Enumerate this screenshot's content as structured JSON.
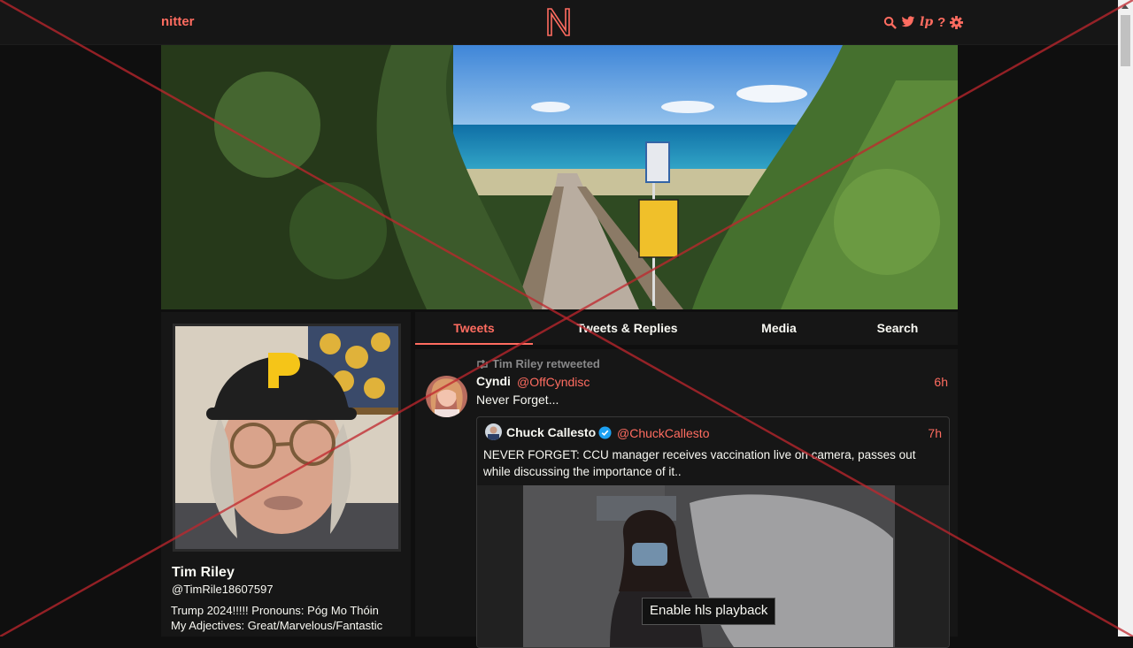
{
  "nav": {
    "brand": "nitter",
    "logo_letter": "N",
    "icons": [
      "search-icon",
      "twitter-bird-icon",
      "liberapay-icon",
      "help-icon",
      "settings-gear-icon"
    ],
    "lp_glyph": "lp",
    "help_glyph": "?"
  },
  "profile": {
    "fullname": "Tim Riley",
    "username": "@TimRile18607597",
    "bio_line1": "Trump 2024!!!!! Pronouns: Póg Mo Thóin",
    "bio_line2": "My Adjectives: Great/Marvelous/Fantastic"
  },
  "tabs": [
    {
      "label": "Tweets",
      "active": true
    },
    {
      "label": "Tweets & Replies",
      "active": false
    },
    {
      "label": "Media",
      "active": false
    },
    {
      "label": "Search",
      "active": false
    }
  ],
  "tweet": {
    "retweet_header": "Tim Riley retweeted",
    "fullname": "Cyndi",
    "username": "@OffCyndisc",
    "time": "6h",
    "text": "Never Forget...",
    "quote": {
      "fullname": "Chuck Callesto",
      "verified": true,
      "username": "@ChuckCallesto",
      "time": "7h",
      "text": "NEVER FORGET: CCU manager receives vaccination live on camera, passes out while discussing the importance of it..",
      "video_button": "Enable hls playback"
    }
  },
  "colors": {
    "accent": "#ff6c60",
    "background": "#0f0f0f",
    "panel": "#161616",
    "text": "#f8f8f2",
    "muted": "#888889"
  }
}
